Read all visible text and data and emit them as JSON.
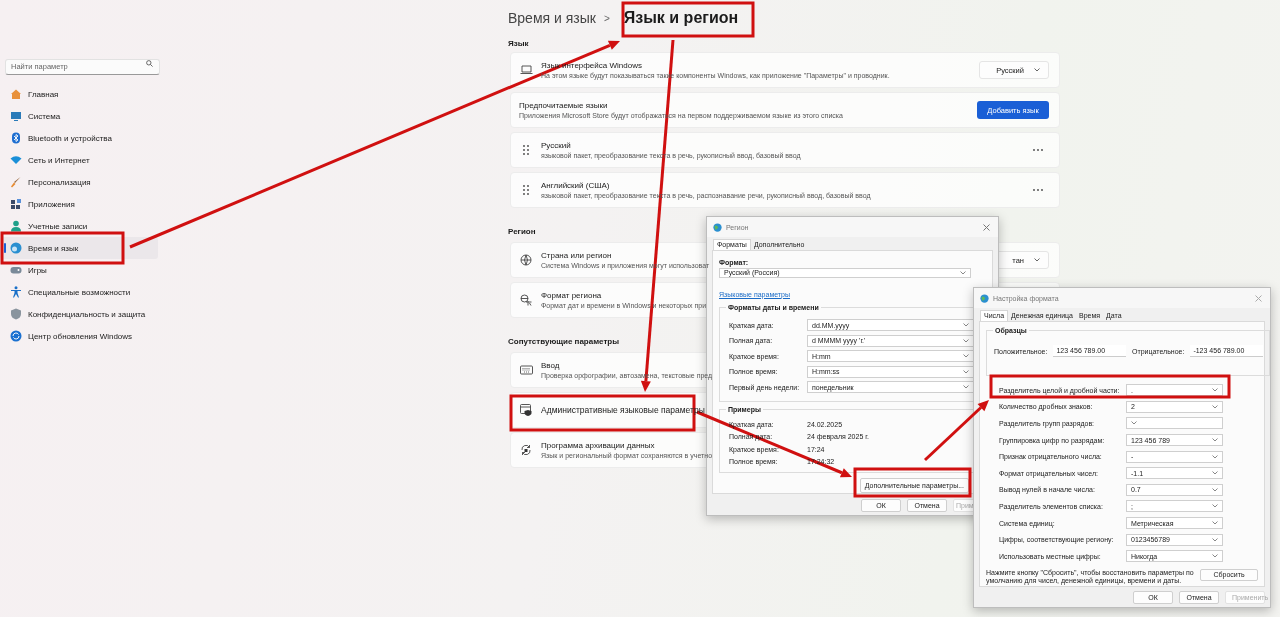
{
  "sidebar": {
    "search": {
      "placeholder": "Найти параметр"
    },
    "items": [
      {
        "label": "Главная",
        "selected": false
      },
      {
        "label": "Система",
        "selected": false
      },
      {
        "label": "Bluetooth и устройства",
        "selected": false
      },
      {
        "label": "Сеть и Интернет",
        "selected": false
      },
      {
        "label": "Персонализация",
        "selected": false
      },
      {
        "label": "Приложения",
        "selected": false
      },
      {
        "label": "Учетные записи",
        "selected": false
      },
      {
        "label": "Время и язык",
        "selected": true
      },
      {
        "label": "Игры",
        "selected": false
      },
      {
        "label": "Специальные возможности",
        "selected": false
      },
      {
        "label": "Конфиденциальность и защита",
        "selected": false
      },
      {
        "label": "Центр обновления Windows",
        "selected": false
      }
    ]
  },
  "breadcrumb": {
    "parent": "Время и язык",
    "separator": ">",
    "current": "Язык и регион"
  },
  "sections": [
    {
      "title": "Язык",
      "cards": [
        {
          "kind": "dropdown",
          "title": "Язык интерфейса Windows",
          "description": "На этом языке будут показываться такие компоненты Windows, как приложение \"Параметры\" и проводник.",
          "value": "Русский"
        },
        {
          "kind": "action",
          "title": "Предпочитаемые языки",
          "description": "Приложения Microsoft Store будут отображаться на первом поддерживаемом языке из этого списка",
          "button": "Добавить язык"
        },
        {
          "kind": "language",
          "title": "Русский",
          "description": "языковой пакет, преобразование текста в речь, рукописный ввод, базовый ввод"
        },
        {
          "kind": "language",
          "title": "Английский (США)",
          "description": "языковой пакет, преобразование текста в речь, распознавание речи, рукописный ввод, базовый ввод"
        }
      ]
    },
    {
      "title": "Регион",
      "cards": [
        {
          "kind": "dropdown",
          "title": "Страна или регион",
          "description": "Система Windows и приложения могут использоват",
          "value": "тан"
        },
        {
          "kind": "link",
          "title": "Формат региона",
          "description": "Формат дат и времени в Windows и некоторых при"
        }
      ]
    },
    {
      "title": "Сопутствующие параметры",
      "cards": [
        {
          "kind": "link",
          "title": "Ввод",
          "description": "Проверка орфографии, автозамена, текстовые пред"
        },
        {
          "kind": "link",
          "title": "Административные языковые параметры"
        },
        {
          "kind": "link",
          "title": "Программа архивации данных",
          "description": "Язык и региональный формат сохраняются в учетно"
        }
      ]
    }
  ],
  "region_dialog": {
    "title": "Регион",
    "tabs": [
      {
        "label": "Форматы",
        "selected": true
      },
      {
        "label": "Дополнительно",
        "selected": false
      }
    ],
    "format_label": "Формат:",
    "format_value": "Русский (Россия)",
    "link": "Языковые параметры",
    "formats_group": {
      "title": "Форматы даты и времени",
      "rows": [
        {
          "label": "Краткая дата:",
          "value": "dd.MM.yyyy"
        },
        {
          "label": "Полная дата:",
          "value": "d MMMM yyyy 'г.'"
        },
        {
          "label": "Краткое время:",
          "value": "H:mm"
        },
        {
          "label": "Полное время:",
          "value": "H:mm:ss"
        },
        {
          "label": "Первый день недели:",
          "value": "понедельник"
        }
      ]
    },
    "examples_group": {
      "title": "Примеры",
      "rows": [
        {
          "label": "Краткая дата:",
          "value": "24.02.2025"
        },
        {
          "label": "Полная дата:",
          "value": "24 февраля 2025 г."
        },
        {
          "label": "Краткое время:",
          "value": "17:24"
        },
        {
          "label": "Полное время:",
          "value": "17:24:32"
        }
      ]
    },
    "more_button": "Дополнительные параметры...",
    "buttons": [
      {
        "label": "ОК",
        "disabled": false
      },
      {
        "label": "Отмена",
        "disabled": false
      },
      {
        "label": "Прим",
        "disabled": true
      }
    ]
  },
  "format_dialog": {
    "title": "Настройка формата",
    "tabs": [
      {
        "label": "Числа",
        "selected": true
      },
      {
        "label": "Денежная единица",
        "selected": false
      },
      {
        "label": "Время",
        "selected": false
      },
      {
        "label": "Дата",
        "selected": false
      }
    ],
    "samples": {
      "title": "Образцы",
      "positive_label": "Положительное:",
      "positive_value": "123 456 789.00",
      "negative_label": "Отрицательное:",
      "negative_value": "-123 456 789.00"
    },
    "rows": [
      {
        "label": "Разделитель целой и дробной части:",
        "value": "."
      },
      {
        "label": "Количество дробных знаков:",
        "value": "2"
      },
      {
        "label": "Разделитель групп разрядов:",
        "value": ""
      },
      {
        "label": "Группировка цифр по разрядам:",
        "value": "123 456 789"
      },
      {
        "label": "Признак отрицательного числа:",
        "value": "-"
      },
      {
        "label": "Формат отрицательных чисел:",
        "value": "-1.1"
      },
      {
        "label": "Вывод нулей в начале числа:",
        "value": "0.7"
      },
      {
        "label": "Разделитель элементов списка:",
        "value": ";"
      },
      {
        "label": "Система единиц:",
        "value": "Метрическая"
      },
      {
        "label": "Цифры, соответствующие региону:",
        "value": "0123456789"
      },
      {
        "label": "Использовать местные цифры:",
        "value": "Никогда"
      }
    ],
    "note": "Нажмите кнопку \"Сбросить\", чтобы восстановить параметры по умолчанию для чисел, денежной единицы, времени и даты.",
    "reset_button": "Сбросить",
    "buttons": [
      {
        "label": "ОК",
        "disabled": false
      },
      {
        "label": "Отмена",
        "disabled": false
      },
      {
        "label": "Применить",
        "disabled": true
      }
    ]
  }
}
